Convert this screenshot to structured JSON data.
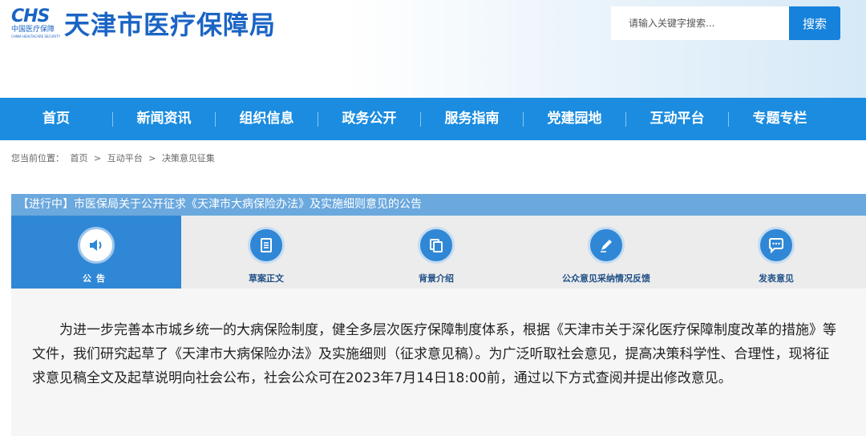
{
  "header": {
    "logo_mark": "CHS",
    "logo_cn": "中国医疗保障",
    "logo_en": "CHINA HEALTHCARE SECURITY",
    "title": "天津市医疗保障局"
  },
  "search": {
    "placeholder": "请输入关键字搜索...",
    "button": "搜索"
  },
  "nav": {
    "items": [
      {
        "label": "首页"
      },
      {
        "label": "新闻资讯"
      },
      {
        "label": "组织信息"
      },
      {
        "label": "政务公开"
      },
      {
        "label": "服务指南"
      },
      {
        "label": "党建园地"
      },
      {
        "label": "互动平台"
      },
      {
        "label": "专题专栏"
      }
    ],
    "color": "#1b8ce0"
  },
  "breadcrumb": {
    "prefix": "您当前位置：",
    "items": [
      "首页",
      ">",
      "互动平台",
      ">",
      "决策意见征集"
    ]
  },
  "notice": {
    "title": "【进行中】市医保局关于公开征求《天津市大病保险办法》及实施细则意见的公告",
    "tabs": [
      {
        "label": "公告",
        "icon": "speaker-icon"
      },
      {
        "label": "草案正文",
        "icon": "document-icon"
      },
      {
        "label": "背景介绍",
        "icon": "copy-icon"
      },
      {
        "label": "公众意见采纳情况反馈",
        "icon": "pen-icon"
      },
      {
        "label": "发表意见",
        "icon": "chat-icon"
      }
    ],
    "active_tab": "公告",
    "body": "为进一步完善本市城乡统一的大病保险制度，健全多层次医疗保障制度体系，根据《天津市关于深化医疗保障制度改革的措施》等文件，我们研究起草了《天津市大病保险办法》及实施细则（征求意见稿）。为广泛听取社会意见，提高决策科学性、合理性，现将征求意见稿全文及起草说明向社会公布，社会公众可在2023年7月14日18:00前，通过以下方式查阅并提出修改意见。"
  },
  "colors": {
    "accent": "#1682dc",
    "title_bar": "#6aa8de",
    "active_tab": "#2f87d6"
  }
}
